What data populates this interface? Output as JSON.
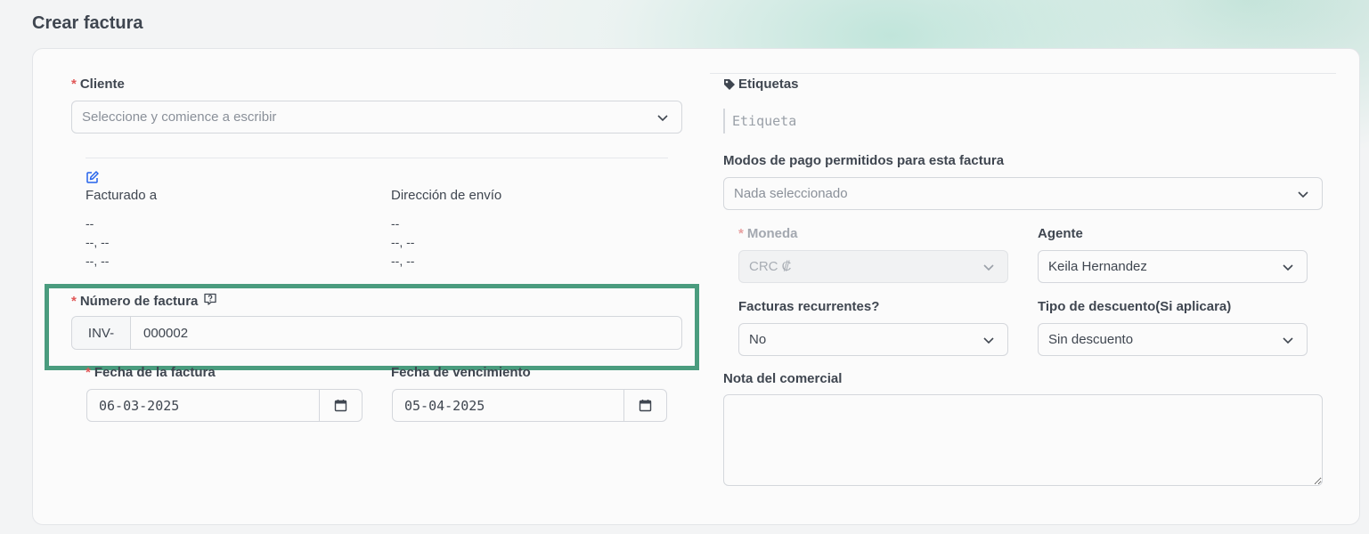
{
  "page_title": "Crear factura",
  "client": {
    "label": "Cliente",
    "placeholder": "Seleccione y comience a escribir"
  },
  "edit_icon": "edit-pencil-icon",
  "billing": {
    "billed_to_label": "Facturado a",
    "billed_to_lines": [
      "--",
      "--, --",
      "--, --"
    ],
    "shipping_label": "Dirección de envío",
    "shipping_lines": [
      "--",
      "--, --",
      "--, --"
    ]
  },
  "invoice_number": {
    "label": "Número de factura",
    "help_icon": "help-bubble-icon",
    "prefix": "INV-",
    "value": "000002"
  },
  "invoice_date": {
    "label": "Fecha de la factura",
    "value": "06-03-2025"
  },
  "due_date": {
    "label": "Fecha de vencimiento",
    "value": "05-04-2025"
  },
  "tags": {
    "label": "Etiquetas",
    "placeholder": "Etiqueta"
  },
  "payment_modes": {
    "label": "Modos de pago permitidos para esta factura",
    "placeholder": "Nada seleccionado"
  },
  "currency": {
    "label": "Moneda",
    "value": "CRC ₡"
  },
  "agent": {
    "label": "Agente",
    "value": "Keila Hernandez"
  },
  "recurring": {
    "label": "Facturas recurrentes?",
    "value": "No"
  },
  "discount": {
    "label": "Tipo de descuento(Si aplicara)",
    "value": "Sin descuento"
  },
  "note": {
    "label": "Nota del comercial",
    "value": ""
  },
  "colors": {
    "highlight": "#4a9c7e",
    "required": "#e05757",
    "edit_icon": "#2563eb"
  }
}
